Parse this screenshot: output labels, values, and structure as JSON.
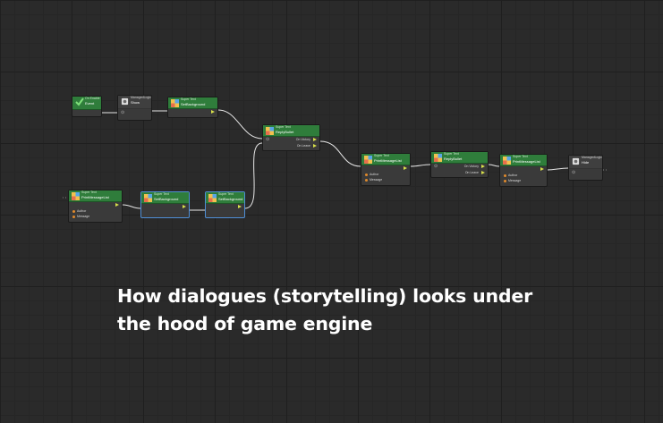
{
  "caption": {
    "line1": "How dialogues (storytelling) looks under",
    "line2": "the hood of game engine"
  },
  "nodes": {
    "on_enable": {
      "category": "On Enable",
      "title": "Event",
      "icon": "check-icon"
    },
    "show": {
      "category": "ManagedLogic",
      "title": "Show",
      "icon": "gear-icon"
    },
    "set_bg_1": {
      "category": "Super Text",
      "title": "SetBackground",
      "icon": "puzzle-icon"
    },
    "reply_bullet_1": {
      "category": "Super Text",
      "title": "ReplyBullet",
      "out1": "On Victory",
      "out2": "On Leave",
      "icon": "puzzle-icon"
    },
    "print_msg_1": {
      "category": "Super Text",
      "title": "PrintMessageList",
      "in1": "Author",
      "in2": "Message",
      "icon": "puzzle-icon"
    },
    "reply_bullet_2": {
      "category": "Super Text",
      "title": "ReplyBullet",
      "out1": "On Victory",
      "out2": "On Leave",
      "icon": "puzzle-icon"
    },
    "print_msg_2": {
      "category": "Super Text",
      "title": "PrintMessageList",
      "in1": "Author",
      "in2": "Message",
      "icon": "puzzle-icon"
    },
    "hide": {
      "category": "ManagedLogic",
      "title": "Hide",
      "icon": "gear-icon"
    },
    "print_msg_3": {
      "category": "Super Text",
      "title": "PrintMessageList",
      "in1": "Author",
      "in2": "Message",
      "icon": "puzzle-icon"
    },
    "set_bg_2": {
      "category": "Super Text",
      "title": "SetBackground",
      "icon": "puzzle-icon"
    },
    "set_bg_3": {
      "category": "Super Text",
      "title": "SetBackground",
      "icon": "puzzle-icon"
    }
  },
  "colors": {
    "canvas": "#2a2a2a",
    "node_header": "#2f7d3b",
    "node_body": "#3a3a3a",
    "flow_pin": "#d7e04a",
    "data_pin": "#e08a2c",
    "selection": "#4f8fd6",
    "caption": "#ffffff"
  }
}
